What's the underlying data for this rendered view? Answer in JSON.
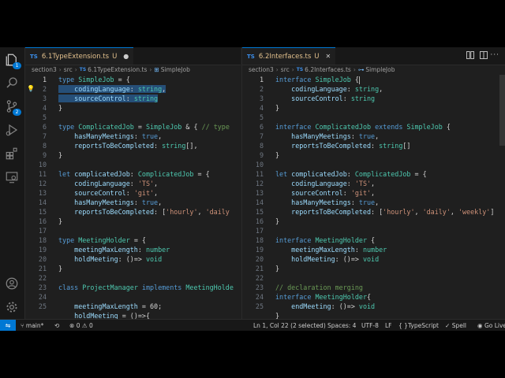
{
  "activity_bar": {
    "explorer_badge": "1",
    "source_control_badge": "2"
  },
  "left_editor": {
    "tab": {
      "lang": "TS",
      "name": "6.1TypeExtension.ts",
      "status": "U"
    },
    "breadcrumb": [
      "section3",
      "src",
      "6.1TypeExtension.ts",
      "SimpleJob"
    ],
    "line_numbers": [
      "1",
      "2",
      "3",
      "4",
      "5",
      "6",
      "7",
      "8",
      "9",
      "10",
      "11",
      "12",
      "13",
      "14",
      "15",
      "16",
      "17",
      "18",
      "19",
      "20",
      "21",
      "22",
      "23",
      "24",
      "25"
    ],
    "lines": [
      "type SimpleJob = {",
      "    codingLanguage: string,",
      "    sourceControl: string",
      "}",
      "",
      "type ComplicatedJob = SimpleJob & { // type",
      "    hasManyMeetings: true,",
      "    reportsToBeCompleted: string[],",
      "}",
      "",
      "let complicatedJob: ComplicatedJob = {",
      "    codingLanguage: 'TS',",
      "    sourceControl: 'git',",
      "    hasManyMeetings: true,",
      "    reportsToBeCompleted: ['hourly', 'daily",
      "}",
      "",
      "type MeetingHolder = {",
      "    meetingMaxLength: number",
      "    holdMeeting: ()=> void",
      "}",
      "",
      "class ProjectManager implements MeetingHolde",
      "",
      "    meetingMaxLength = 60;",
      "    holdMeeting = ()=>{"
    ]
  },
  "right_editor": {
    "tab": {
      "lang": "TS",
      "name": "6.2Interfaces.ts",
      "status": "U"
    },
    "breadcrumb": [
      "section3",
      "src",
      "6.2Interfaces.ts",
      "SimpleJob"
    ],
    "line_numbers": [
      "1",
      "2",
      "3",
      "4",
      "5",
      "6",
      "7",
      "8",
      "9",
      "10",
      "11",
      "12",
      "13",
      "14",
      "15",
      "16",
      "17",
      "18",
      "19",
      "20",
      "21",
      "22",
      "23",
      "24",
      "25"
    ],
    "lines": [
      "interface SimpleJob {",
      "    codingLanguage: string,",
      "    sourceControl: string",
      "}",
      "",
      "interface ComplicatedJob extends SimpleJob {",
      "    hasManyMeetings: true,",
      "    reportsToBeCompleted: string[]",
      "}",
      "",
      "let complicatedJob: ComplicatedJob = {",
      "    codingLanguage: 'TS',",
      "    sourceControl: 'git',",
      "    hasManyMeetings: true,",
      "    reportsToBeCompleted: ['hourly', 'daily', 'weekly']",
      "}",
      "",
      "interface MeetingHolder {",
      "    meetingMaxLength: number",
      "    holdMeeting: ()=> void",
      "}",
      "",
      "// declaration merging",
      "interface MeetingHolder{",
      "    endMeeting: ()=> void",
      "}"
    ]
  },
  "status_bar": {
    "branch": "main*",
    "problems": "0",
    "warnings": "0",
    "cursor": "Ln 1, Col 22 (2 selected)",
    "spaces": "Spaces: 4",
    "encoding": "UTF-8",
    "eol": "LF",
    "language_braces": "{ }",
    "language": "TypeScript",
    "spell": "Spell",
    "extension": "Go Live"
  },
  "colors": {
    "keyword": "#569cd6",
    "type": "#4ec9b0",
    "property": "#9cdcfe",
    "string": "#ce9178",
    "comment": "#6a9955",
    "accent": "#0078d4",
    "selection": "#264f78"
  }
}
